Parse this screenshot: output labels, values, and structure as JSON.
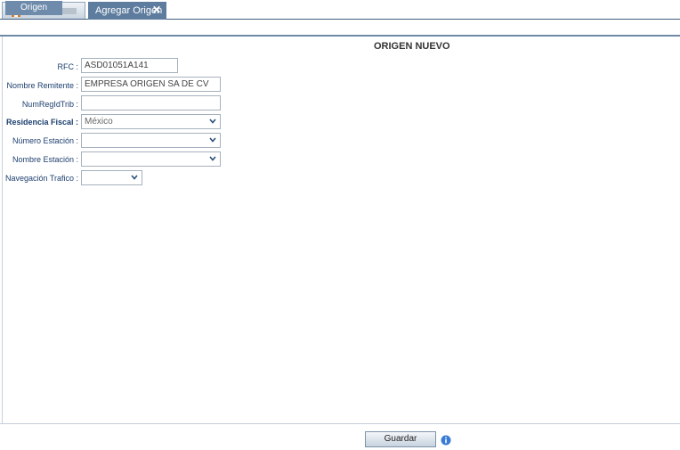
{
  "tabs": {
    "active_label": "Agregar Origen",
    "close_glyph": "✕"
  },
  "subtabs": {
    "active_label": "Origen"
  },
  "form": {
    "title": "ORIGEN NUEVO",
    "rfc": {
      "label": "RFC :",
      "value": "ASD01051A141"
    },
    "nombre_remitente": {
      "label": "Nombre Remitente :",
      "value": "EMPRESA ORIGEN SA DE CV"
    },
    "num_reg_id_trib": {
      "label": "NumRegIdTrib :",
      "value": ""
    },
    "residencia_fiscal": {
      "label": "Residencia Fiscal :",
      "value": "México"
    },
    "numero_estacion": {
      "label": "Número Estación :",
      "value": ""
    },
    "nombre_estacion": {
      "label": "Nombre Estación :",
      "value": ""
    },
    "navegacion_trafico": {
      "label": "Navegación Trafico :",
      "value": ""
    }
  },
  "footer": {
    "save_label": "Guardar"
  },
  "icons": {
    "home": "home-icon",
    "info": "info-icon",
    "close": "close-icon",
    "dropdown": "chevron-down-icon"
  },
  "colors": {
    "tab_active": "#5e7d9e",
    "label_text": "#1d3f6e",
    "accent_line": "#3f5e7e"
  }
}
